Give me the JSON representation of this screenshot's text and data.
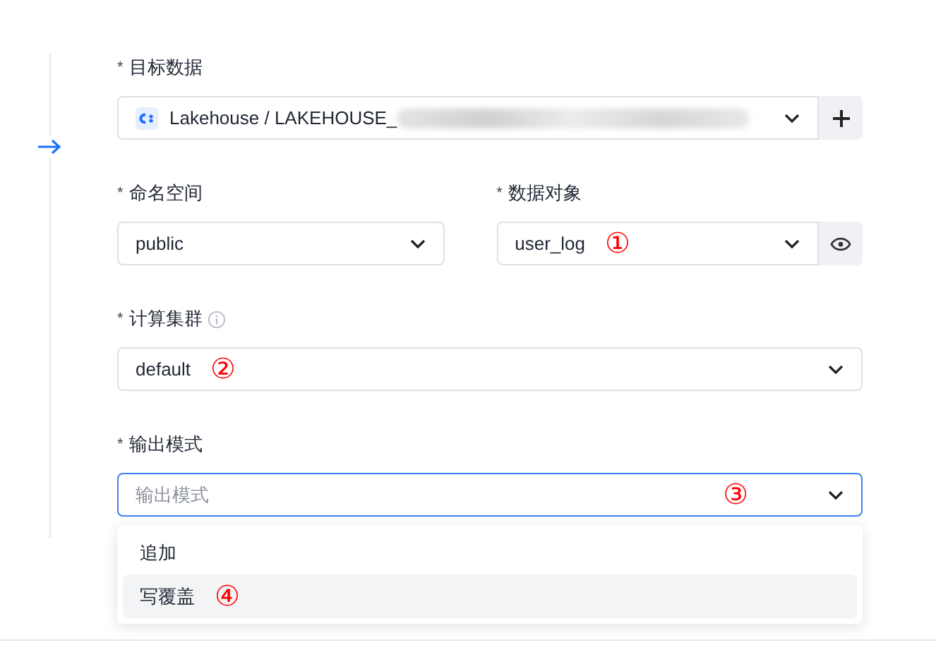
{
  "fields": [
    {
      "kind": "data",
      "label": "目标数据",
      "required": true,
      "value": "Lakehouse / LAKEHOUSE_",
      "redacted": true,
      "side_button": {
        "kind": "plus"
      }
    },
    {
      "kind": "pair",
      "items": [
        {
          "label": "命名空间",
          "required": true,
          "value": "public"
        },
        {
          "label": "数据对象",
          "required": true,
          "value": "user_log",
          "annotation": "①",
          "side_button": {
            "kind": "eye"
          }
        }
      ]
    },
    {
      "kind": "select",
      "label": "计算集群",
      "required": true,
      "info": true,
      "value": "default",
      "annotation": "②"
    },
    {
      "kind": "select",
      "label": "输出模式",
      "required": true,
      "placeholder": "输出模式",
      "annotation": "③",
      "focused": true,
      "options": [
        {
          "label": "追加",
          "selected": false
        },
        {
          "label": "写覆盖",
          "selected": true,
          "annotation": "④"
        }
      ]
    }
  ],
  "required_mark": "*"
}
